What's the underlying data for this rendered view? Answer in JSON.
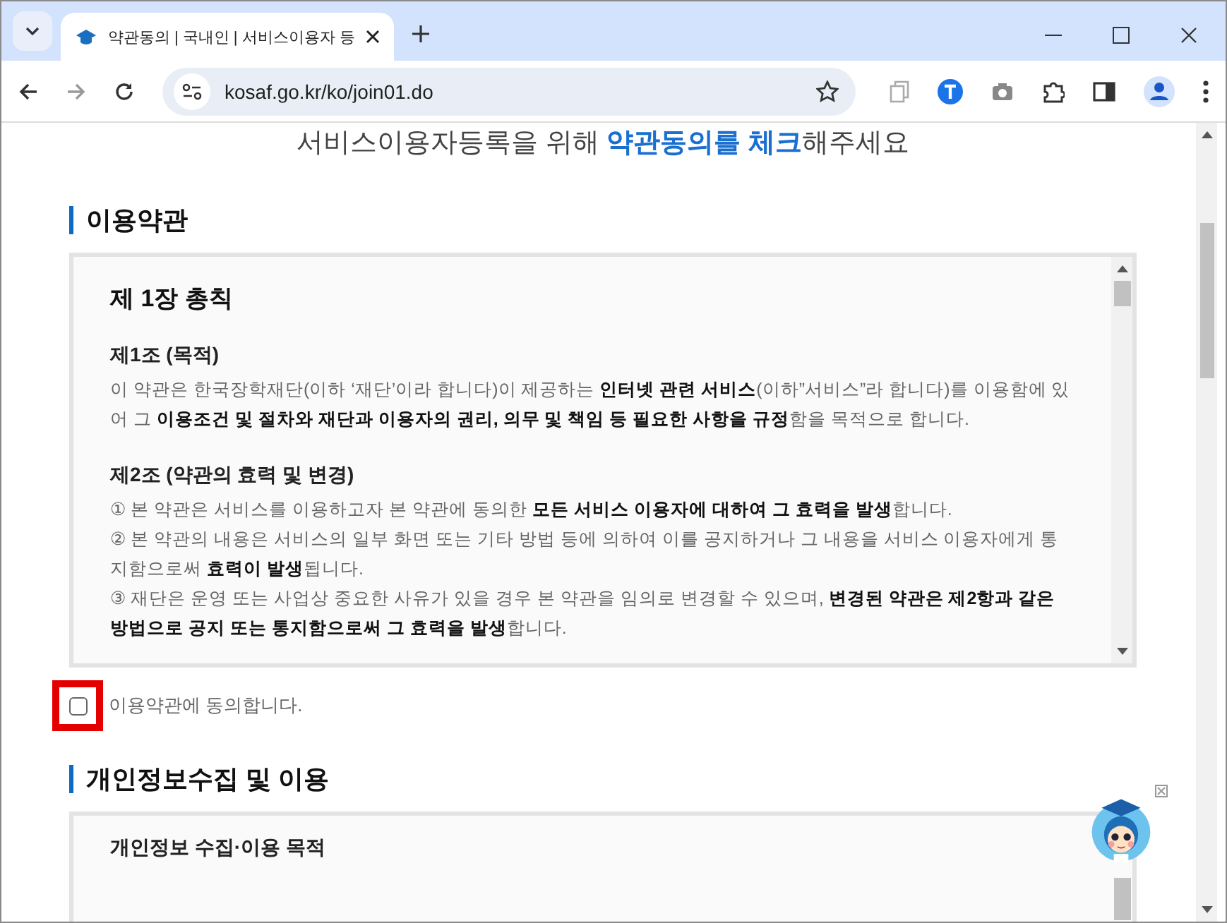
{
  "browser": {
    "tabs": [
      {
        "title": "약관동의 | 국내인 | 서비스이용자 등",
        "selected": true
      }
    ],
    "url": "kosaf.go.kr/ko/join01.do"
  },
  "intro": "서비스이용자등록을 위해 **약관동의를 체크**해주세요",
  "sections": [
    {
      "title": "이용약관",
      "chapter": "제 1장 총칙",
      "articles": [
        {
          "title": "제1조 (목적)",
          "paragraphs": [
            "이 약관은 한국장학재단(이하 ‘재단’이라 합니다)이 제공하는 **인터넷 관련 서비스**(이하”서비스”라 합니다)를 이용함에 있어 그 **이용조건 및 절차와 재단과 이용자의 권리, 의무 및 책임 등 필요한 사항을 규정**함을 목적으로 합니다."
          ]
        },
        {
          "title": "제2조 (약관의 효력 및 변경)",
          "paragraphs": [
            "① 본 약관은 서비스를 이용하고자 본 약관에 동의한 **모든 서비스 이용자에 대하여 그 효력을 발생**합니다.",
            "② 본 약관의 내용은 서비스의 일부 화면 또는 기타 방법 등에 의하여 이를 공지하거나 그 내용을 서비스 이용자에게 통지함으로써 **효력이 발생**됩니다.",
            "③ 재단은 운영 또는 사업상 중요한 사유가 있을 경우 본 약관을 임의로 변경할 수 있으며, **변경된 약관은 제2항과 같은 방법으로 공지 또는 통지함으로써 그 효력을 발생**합니다."
          ]
        }
      ],
      "agree": {
        "label": "이용약관에 동의합니다.",
        "checked": false,
        "highlighted": true
      }
    },
    {
      "title": "개인정보수집 및 이용",
      "articles": [
        {
          "title": "개인정보 수집·이용 목적"
        }
      ]
    }
  ]
}
